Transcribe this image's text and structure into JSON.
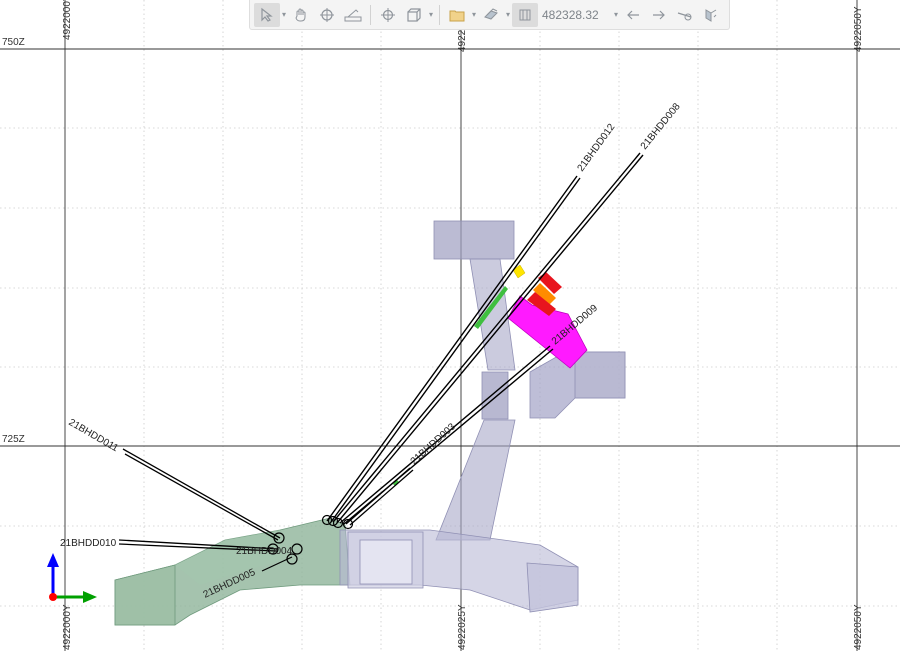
{
  "view": {
    "elevation_labels": [
      "750Z",
      "725Z"
    ],
    "northing_top": [
      "4922000Y",
      "4922025Y",
      "4922050Y"
    ],
    "northing_bottom": [
      "4922000Y",
      "4922025Y",
      "4922050Y"
    ]
  },
  "drillholes": [
    "21BHDD012",
    "21BHDD008",
    "21BHDD009",
    "21BHDD003",
    "21BHDD011",
    "21BHDD010",
    "21BHDD004",
    "21BHDD005"
  ],
  "toolbar": {
    "coordinate_value": "482328.32",
    "tools": [
      "select-arrow-icon",
      "pan-hand-icon",
      "crosshair-icon",
      "ruler-icon",
      "center-target-icon",
      "box-view-icon",
      "folder-clip-icon",
      "layers-icon",
      "section-view-icon",
      "back-arrow-icon",
      "forward-arrow-icon",
      "eye-arrow-icon",
      "section-flip-icon"
    ]
  },
  "axes_triad": {
    "labels": []
  },
  "colors": {
    "background": "#ffffff",
    "grid": "#cccccc",
    "grid_major": "#333333",
    "tunnel": "#a9a9c8",
    "drift_green": "#8fb49a",
    "assay_magenta": "#ff1aff",
    "assay_red": "#e8141e",
    "assay_orange": "#ff8c00",
    "assay_yellow": "#ffe500",
    "assay_green": "#3fbf3f",
    "axis_blue": "#0000ff",
    "axis_green": "#00a000",
    "axis_red": "#ff0000"
  }
}
